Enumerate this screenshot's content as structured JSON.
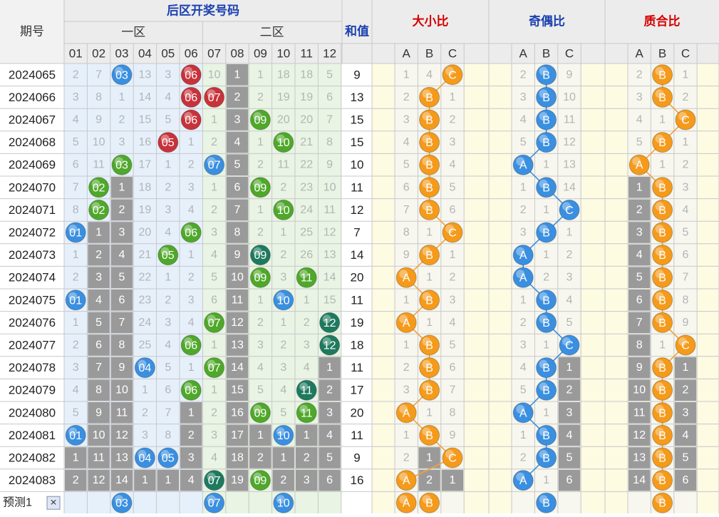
{
  "chart_data": {
    "type": "table",
    "headers": {
      "period": "期号",
      "back_zone": "后区开奖号码",
      "zone1": "一区",
      "zone2": "二区",
      "sum": "和值",
      "size_ratio": "大小比",
      "odd_even_ratio": "奇偶比",
      "prime_ratio": "质合比"
    },
    "number_columns": [
      "01",
      "02",
      "03",
      "04",
      "05",
      "06",
      "07",
      "08",
      "09",
      "10",
      "11",
      "12"
    ],
    "ratio_columns": [
      "A",
      "B",
      "C"
    ],
    "rows": [
      {
        "period": "2024065",
        "cells": [
          "2",
          "7",
          "03",
          "13",
          "3",
          "06",
          "10",
          "1",
          "1",
          "18",
          "18",
          "5"
        ],
        "hits": [
          3,
          6
        ],
        "sum": "9",
        "r1": [
          "1",
          "4",
          "C"
        ],
        "r2": [
          "2",
          "B",
          "9"
        ],
        "r3": [
          "2",
          "B",
          "1"
        ]
      },
      {
        "period": "2024066",
        "cells": [
          "3",
          "8",
          "1",
          "14",
          "4",
          "06",
          "07",
          "2",
          "2",
          "19",
          "19",
          "6"
        ],
        "hits": [
          6,
          7
        ],
        "sum": "13",
        "r1": [
          "2",
          "B",
          "1"
        ],
        "r2": [
          "3",
          "B",
          "10"
        ],
        "r3": [
          "3",
          "B",
          "2"
        ]
      },
      {
        "period": "2024067",
        "cells": [
          "4",
          "9",
          "2",
          "15",
          "5",
          "06",
          "1",
          "3",
          "09",
          "20",
          "20",
          "7"
        ],
        "hits": [
          6,
          9
        ],
        "sum": "15",
        "r1": [
          "3",
          "B",
          "2"
        ],
        "r2": [
          "4",
          "B",
          "11"
        ],
        "r3": [
          "4",
          "1",
          "C"
        ]
      },
      {
        "period": "2024068",
        "cells": [
          "5",
          "10",
          "3",
          "16",
          "05",
          "1",
          "2",
          "4",
          "1",
          "10",
          "21",
          "8"
        ],
        "hits": [
          5,
          10
        ],
        "sum": "15",
        "r1": [
          "4",
          "B",
          "3"
        ],
        "r2": [
          "5",
          "B",
          "12"
        ],
        "r3": [
          "5",
          "B",
          "1"
        ]
      },
      {
        "period": "2024069",
        "cells": [
          "6",
          "11",
          "03",
          "17",
          "1",
          "2",
          "07",
          "5",
          "2",
          "11",
          "22",
          "9"
        ],
        "hits": [
          3,
          7
        ],
        "sum": "10",
        "r1": [
          "5",
          "B",
          "4"
        ],
        "r2": [
          "A",
          "1",
          "13"
        ],
        "r3": [
          "A",
          "1",
          "2"
        ]
      },
      {
        "period": "2024070",
        "cells": [
          "7",
          "02",
          "1",
          "18",
          "2",
          "3",
          "1",
          "6",
          "09",
          "2",
          "23",
          "10"
        ],
        "hits": [
          2,
          9
        ],
        "sum": "11",
        "r1": [
          "6",
          "B",
          "5"
        ],
        "r2": [
          "1",
          "B",
          "14"
        ],
        "r3": [
          "1",
          "B",
          "3"
        ]
      },
      {
        "period": "2024071",
        "cells": [
          "8",
          "02",
          "2",
          "19",
          "3",
          "4",
          "2",
          "7",
          "1",
          "10",
          "24",
          "11"
        ],
        "hits": [
          2,
          10
        ],
        "sum": "12",
        "r1": [
          "7",
          "B",
          "6"
        ],
        "r2": [
          "2",
          "1",
          "C"
        ],
        "r3": [
          "2",
          "B",
          "4"
        ]
      },
      {
        "period": "2024072",
        "cells": [
          "01",
          "1",
          "3",
          "20",
          "4",
          "06",
          "3",
          "8",
          "2",
          "1",
          "25",
          "12"
        ],
        "hits": [
          1,
          6
        ],
        "sum": "7",
        "r1": [
          "8",
          "1",
          "C"
        ],
        "r2": [
          "3",
          "B",
          "1"
        ],
        "r3": [
          "3",
          "B",
          "5"
        ]
      },
      {
        "period": "2024073",
        "cells": [
          "1",
          "2",
          "4",
          "21",
          "05",
          "1",
          "4",
          "9",
          "09",
          "2",
          "26",
          "13"
        ],
        "hits": [
          5,
          9
        ],
        "sum": "14",
        "r1": [
          "9",
          "B",
          "1"
        ],
        "r2": [
          "A",
          "1",
          "2"
        ],
        "r3": [
          "4",
          "B",
          "6"
        ]
      },
      {
        "period": "2024074",
        "cells": [
          "2",
          "3",
          "5",
          "22",
          "1",
          "2",
          "5",
          "10",
          "09",
          "3",
          "11",
          "14"
        ],
        "hits": [
          9,
          11
        ],
        "sum": "20",
        "r1": [
          "A",
          "1",
          "2"
        ],
        "r2": [
          "A",
          "2",
          "3"
        ],
        "r3": [
          "5",
          "B",
          "7"
        ]
      },
      {
        "period": "2024075",
        "cells": [
          "01",
          "4",
          "6",
          "23",
          "2",
          "3",
          "6",
          "11",
          "1",
          "10",
          "1",
          "15"
        ],
        "hits": [
          1,
          10
        ],
        "sum": "11",
        "r1": [
          "1",
          "B",
          "3"
        ],
        "r2": [
          "1",
          "B",
          "4"
        ],
        "r3": [
          "6",
          "B",
          "8"
        ]
      },
      {
        "period": "2024076",
        "cells": [
          "1",
          "5",
          "7",
          "24",
          "3",
          "4",
          "07",
          "12",
          "2",
          "1",
          "2",
          "12"
        ],
        "hits": [
          7,
          12
        ],
        "sum": "19",
        "r1": [
          "A",
          "1",
          "4"
        ],
        "r2": [
          "2",
          "B",
          "5"
        ],
        "r3": [
          "7",
          "B",
          "9"
        ]
      },
      {
        "period": "2024077",
        "cells": [
          "2",
          "6",
          "8",
          "25",
          "4",
          "06",
          "1",
          "13",
          "3",
          "2",
          "3",
          "12"
        ],
        "hits": [
          6,
          12
        ],
        "sum": "18",
        "r1": [
          "1",
          "B",
          "5"
        ],
        "r2": [
          "3",
          "1",
          "C"
        ],
        "r3": [
          "8",
          "1",
          "C"
        ]
      },
      {
        "period": "2024078",
        "cells": [
          "3",
          "7",
          "9",
          "04",
          "5",
          "1",
          "07",
          "14",
          "4",
          "3",
          "4",
          "1"
        ],
        "hits": [
          4,
          7
        ],
        "sum": "11",
        "r1": [
          "2",
          "B",
          "6"
        ],
        "r2": [
          "4",
          "B",
          "1"
        ],
        "r3": [
          "9",
          "B",
          "1"
        ]
      },
      {
        "period": "2024079",
        "cells": [
          "4",
          "8",
          "10",
          "1",
          "6",
          "06",
          "1",
          "15",
          "5",
          "4",
          "11",
          "2"
        ],
        "hits": [
          6,
          11
        ],
        "sum": "17",
        "r1": [
          "3",
          "B",
          "7"
        ],
        "r2": [
          "5",
          "B",
          "2"
        ],
        "r3": [
          "10",
          "B",
          "2"
        ]
      },
      {
        "period": "2024080",
        "cells": [
          "5",
          "9",
          "11",
          "2",
          "7",
          "1",
          "2",
          "16",
          "09",
          "5",
          "11",
          "3"
        ],
        "hits": [
          9,
          11
        ],
        "sum": "20",
        "r1": [
          "A",
          "1",
          "8"
        ],
        "r2": [
          "A",
          "1",
          "3"
        ],
        "r3": [
          "11",
          "B",
          "3"
        ]
      },
      {
        "period": "2024081",
        "cells": [
          "01",
          "10",
          "12",
          "3",
          "8",
          "2",
          "3",
          "17",
          "1",
          "10",
          "1",
          "4"
        ],
        "hits": [
          1,
          10
        ],
        "sum": "11",
        "r1": [
          "1",
          "B",
          "9"
        ],
        "r2": [
          "1",
          "B",
          "4"
        ],
        "r3": [
          "12",
          "B",
          "4"
        ]
      },
      {
        "period": "2024082",
        "cells": [
          "1",
          "11",
          "13",
          "04",
          "05",
          "3",
          "4",
          "18",
          "2",
          "1",
          "2",
          "5"
        ],
        "hits": [
          4,
          5
        ],
        "sum": "9",
        "r1": [
          "2",
          "1",
          "C"
        ],
        "r2": [
          "2",
          "B",
          "5"
        ],
        "r3": [
          "13",
          "B",
          "5"
        ]
      },
      {
        "period": "2024083",
        "cells": [
          "2",
          "12",
          "14",
          "1",
          "1",
          "4",
          "07",
          "19",
          "09",
          "2",
          "3",
          "6"
        ],
        "hits": [
          7,
          9
        ],
        "sum": "16",
        "r1": [
          "A",
          "2",
          "1"
        ],
        "r2": [
          "A",
          "1",
          "6"
        ],
        "r3": [
          "14",
          "B",
          "6"
        ]
      }
    ],
    "forecast": {
      "label": "预测1",
      "close_mark": "×",
      "numbers": [
        {
          "col": 3,
          "text": "03"
        },
        {
          "col": 7,
          "text": "07"
        },
        {
          "col": 10,
          "text": "10"
        }
      ],
      "r1": [
        {
          "col": 1,
          "text": "A"
        },
        {
          "col": 2,
          "text": "B"
        }
      ],
      "r2": [
        {
          "col": 2,
          "text": "B"
        }
      ],
      "r3": [
        {
          "col": 2,
          "text": "B"
        }
      ]
    },
    "colors": {
      "header_bg": "#ececec",
      "title_blue": "#1a3fb0",
      "title_red": "#d40000",
      "grid_line": "#c8c8c8",
      "zone_bg_blue": "#e6f0fb",
      "zone_bg_green": "#e9f4e4",
      "ratio_bg": "#fdfbe2",
      "gray_bar": "#9a9a9a",
      "ball_red": "#c8323a",
      "ball_blue": "#3a8fe0",
      "ball_green": "#4fa82a",
      "ball_teal": "#1e7a5e",
      "ball_orange": "#f59a1a",
      "missing_text": "#b4b4b4",
      "line_orange": "#f5a040",
      "line_blue": "#3a8fe0"
    }
  }
}
